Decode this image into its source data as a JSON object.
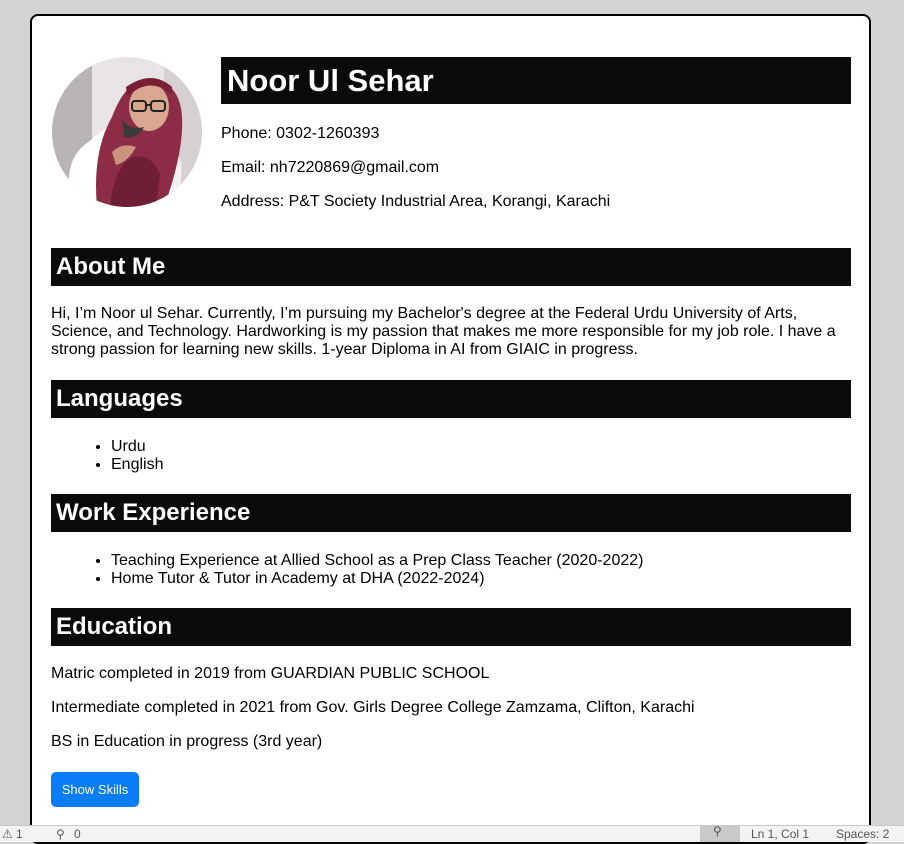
{
  "profile": {
    "name": "Noor Ul Sehar",
    "phone": "Phone: 0302-1260393",
    "email": "Email: nh7220869@gmail.com",
    "address": "Address: P&T Society Industrial Area, Korangi, Karachi"
  },
  "about": {
    "heading": "About Me",
    "text": "Hi, I’m Noor ul Sehar. Currently, I’m pursuing my Bachelor's degree at the Federal Urdu University of Arts, Science, and Technology. Hardworking is my passion that makes me more responsible for my job role. I have a strong passion for learning new skills. 1-year Diploma in AI from GIAIC in progress."
  },
  "languages": {
    "heading": "Languages",
    "items": [
      "Urdu",
      "English"
    ]
  },
  "work": {
    "heading": "Work Experience",
    "items": [
      "Teaching Experience at Allied School as a Prep Class Teacher (2020-2022)",
      "Home Tutor & Tutor in Academy at DHA (2022-2024)"
    ]
  },
  "education": {
    "heading": "Education",
    "items": [
      "Matric completed in 2019 from GUARDIAN PUBLIC SCHOOL",
      "Intermediate completed in 2021 from Gov. Girls Degree College Zamzama, Clifton, Karachi",
      "BS in Education in progress (3rd year)"
    ]
  },
  "skills_button": "Show Skills",
  "statusbar": {
    "warnings": "1",
    "ports": "0",
    "cursor": "Ln 1, Col 1",
    "indent": "Spaces: 2"
  },
  "colors": {
    "heading_bg": "#0a0a0a",
    "button_bg": "#0a7cf5",
    "page_bg": "#d3d3d3"
  }
}
